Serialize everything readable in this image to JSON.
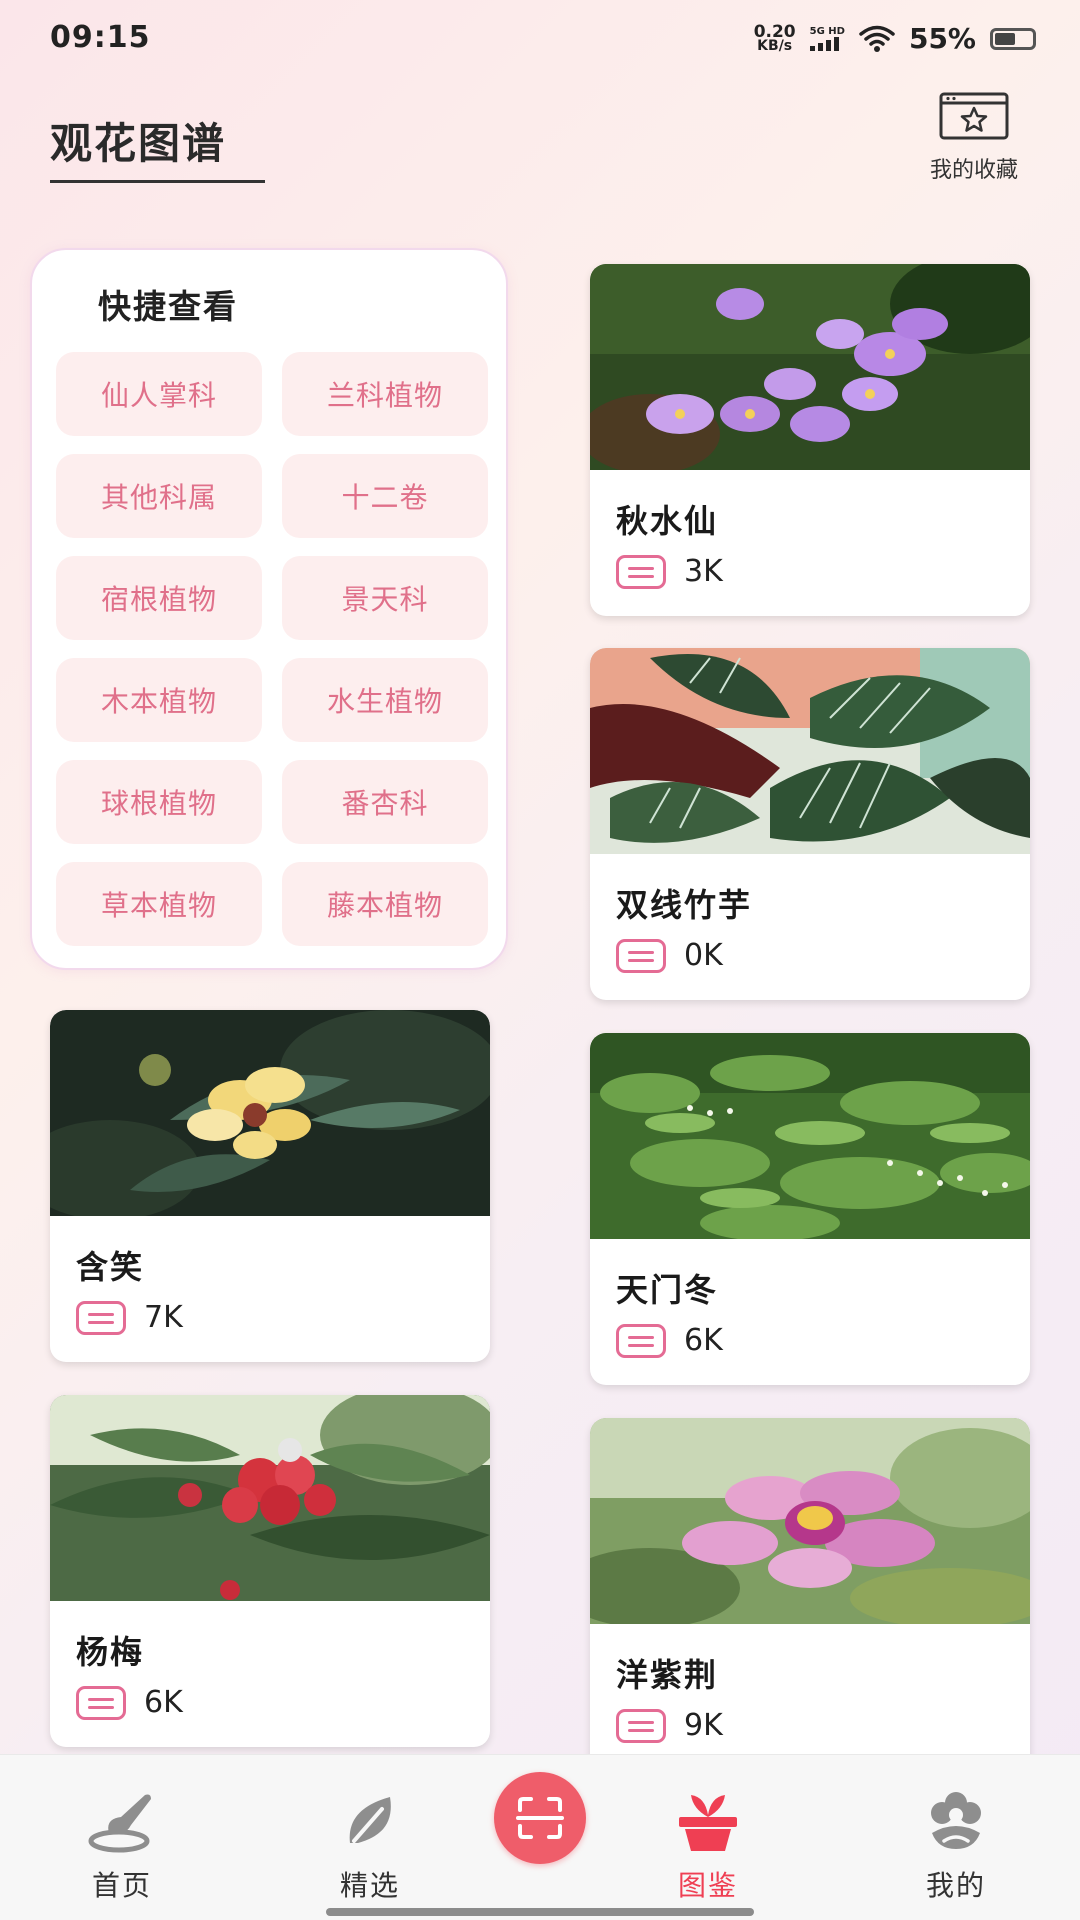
{
  "status_bar": {
    "time": "09:15",
    "net_speed_value": "0.20",
    "net_speed_unit": "KB/s",
    "signal_label_top": "5G HD",
    "battery_percent": "55%",
    "battery_level": 0.55
  },
  "header": {
    "title": "观花图谱",
    "favorites_label": "我的收藏",
    "favorites_icon": "star-window-icon"
  },
  "quick_view": {
    "title": "快捷查看",
    "categories": [
      "仙人掌科",
      "兰科植物",
      "其他科属",
      "十二卷",
      "宿根植物",
      "景天科",
      "木本植物",
      "水生植物",
      "球根植物",
      "番杏科",
      "草本植物",
      "藤本植物"
    ]
  },
  "cards": [
    {
      "name": "秋水仙",
      "count": "3K",
      "image": "purple-crocus-flowers-photo"
    },
    {
      "name": "双线竹芋",
      "count": "0K",
      "image": "striped-calathea-leaves-photo"
    },
    {
      "name": "含笑",
      "count": "7K",
      "image": "yellow-michelia-flower-photo"
    },
    {
      "name": "天门冬",
      "count": "6K",
      "image": "asparagus-fern-photo"
    },
    {
      "name": "杨梅",
      "count": "6K",
      "image": "red-bayberry-fruit-photo"
    },
    {
      "name": "洋紫荆",
      "count": "9K",
      "image": "pink-bauhinia-flower-photo"
    }
  ],
  "bottom_nav": {
    "items": [
      {
        "label": "首页",
        "icon": "brush-icon"
      },
      {
        "label": "精选",
        "icon": "leaf-icon"
      },
      {
        "label": "图鉴",
        "icon": "flower-pot-icon",
        "active": true
      },
      {
        "label": "我的",
        "icon": "flower-profile-icon"
      }
    ],
    "scan_icon": "scan-icon"
  },
  "colors": {
    "accent": "#ef3f53",
    "chip_text": "#e0708a",
    "chip_bg": "#fdeeee",
    "doc_icon": "#e46b94"
  }
}
